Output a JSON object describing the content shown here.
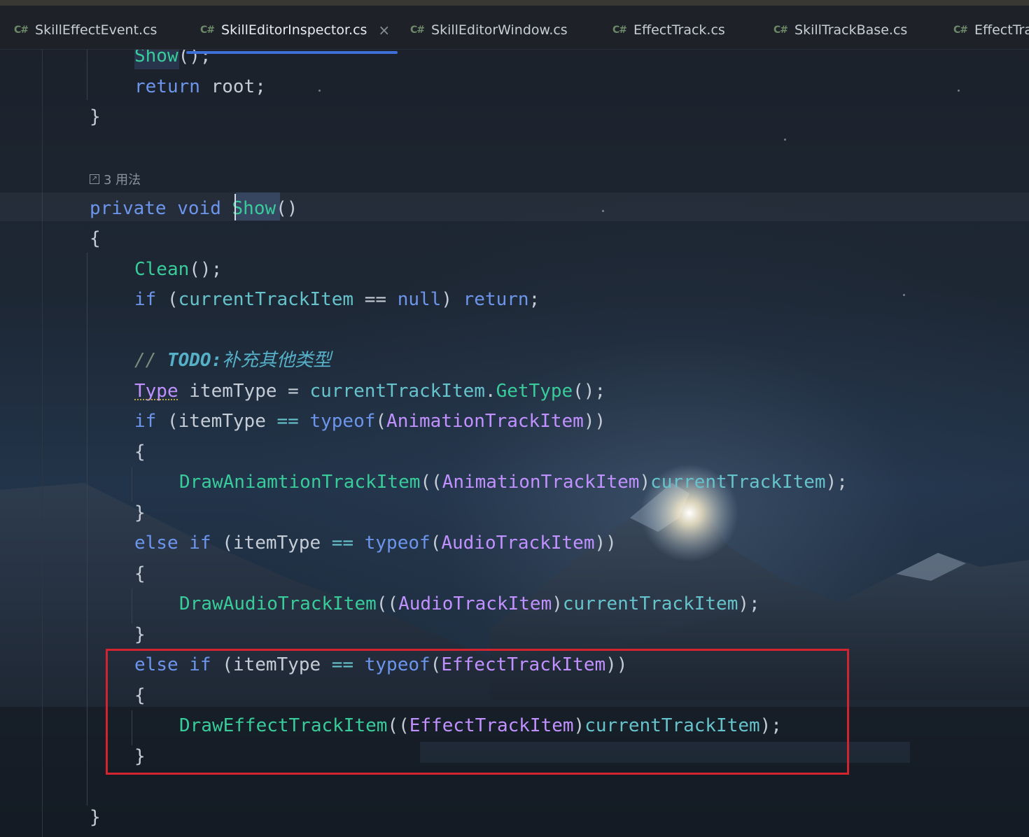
{
  "tabs": [
    {
      "lang": "C#",
      "label": "SkillEffectEvent.cs",
      "active": false
    },
    {
      "lang": "C#",
      "label": "SkillEditorInspector.cs",
      "active": true,
      "close": "×"
    },
    {
      "lang": "C#",
      "label": "SkillEditorWindow.cs",
      "active": false
    },
    {
      "lang": "C#",
      "label": "EffectTrack.cs",
      "active": false
    },
    {
      "lang": "C#",
      "label": "SkillTrackBase.cs",
      "active": false
    },
    {
      "lang": "C#",
      "label": "EffectTra",
      "active": false
    }
  ],
  "usages": {
    "label": "3 用法",
    "icon": "external-link-icon"
  },
  "code": {
    "l1": {
      "a": "Show",
      "b": "();"
    },
    "l2": {
      "a": "return",
      "b": " root;"
    },
    "l3": "}",
    "l4": {
      "a": "private",
      "b": " ",
      "c": "void",
      "d": " ",
      "e": "Show",
      "f": "()"
    },
    "l5": "{",
    "l6": {
      "a": "Clean",
      "b": "();"
    },
    "l7": {
      "a": "if",
      "b": " (",
      "c": "currentTrackItem",
      "d": " == ",
      "e": "null",
      "f": ") ",
      "g": "return",
      "h": ";"
    },
    "l8": {
      "a": "// ",
      "b": "TODO:",
      "c": "补充其他类型"
    },
    "l9": {
      "a": "Type",
      "b": " itemType = ",
      "c": "currentTrackItem",
      "d": ".",
      "e": "GetType",
      "f": "();"
    },
    "l10": {
      "a": "if",
      "b": " (itemType ",
      "c": "==",
      "d": " ",
      "e": "typeof",
      "f": "(",
      "g": "AnimationTrackItem",
      "h": "))"
    },
    "l11": "{",
    "l12": {
      "a": "DrawAniamtionTrackItem",
      "b": "((",
      "c": "AnimationTrackItem",
      "d": ")",
      "e": "currentTrackItem",
      "f": ");"
    },
    "l13": "}",
    "l14": {
      "a": "else",
      "b": " ",
      "c": "if",
      "d": " (itemType ",
      "e": "==",
      "f": " ",
      "g": "typeof",
      "h": "(",
      "i": "AudioTrackItem",
      "j": "))"
    },
    "l15": "{",
    "l16": {
      "a": "DrawAudioTrackItem",
      "b": "((",
      "c": "AudioTrackItem",
      "d": ")",
      "e": "currentTrackItem",
      "f": ");"
    },
    "l17": "}",
    "l18": {
      "a": "else",
      "b": " ",
      "c": "if",
      "d": " (itemType ",
      "e": "==",
      "f": " ",
      "g": "typeof",
      "h": "(",
      "i": "EffectTrackItem",
      "j": "))"
    },
    "l19": "{",
    "l20": {
      "a": "DrawEffectTrackItem",
      "b": "((",
      "c": "EffectTrackItem",
      "d": ")",
      "e": "currentTrackItem",
      "f": ");"
    },
    "l21": "}",
    "l22": "}"
  },
  "colors": {
    "keyword": "#6c95eb",
    "method": "#39cc9b",
    "type": "#c191ff",
    "identifier": "#66c3cc",
    "highlight_box": "#d2232f",
    "active_tab_underline": "#3d6fd6"
  }
}
